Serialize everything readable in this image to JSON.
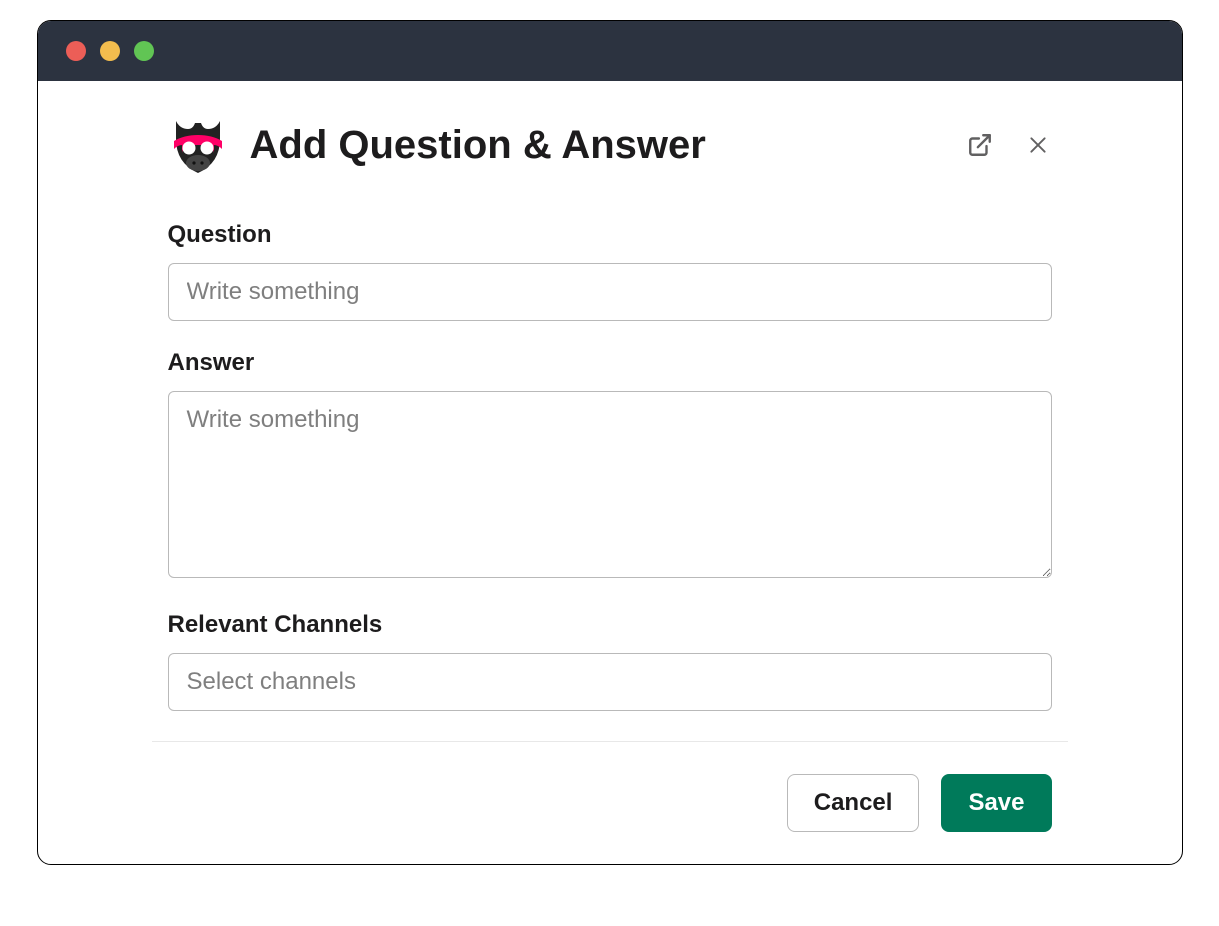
{
  "modal": {
    "title": "Add Question & Answer"
  },
  "fields": {
    "question": {
      "label": "Question",
      "placeholder": "Write something",
      "value": ""
    },
    "answer": {
      "label": "Answer",
      "placeholder": "Write something",
      "value": ""
    },
    "channels": {
      "label": "Relevant Channels",
      "placeholder": "Select channels",
      "value": ""
    }
  },
  "buttons": {
    "cancel": "Cancel",
    "save": "Save"
  }
}
